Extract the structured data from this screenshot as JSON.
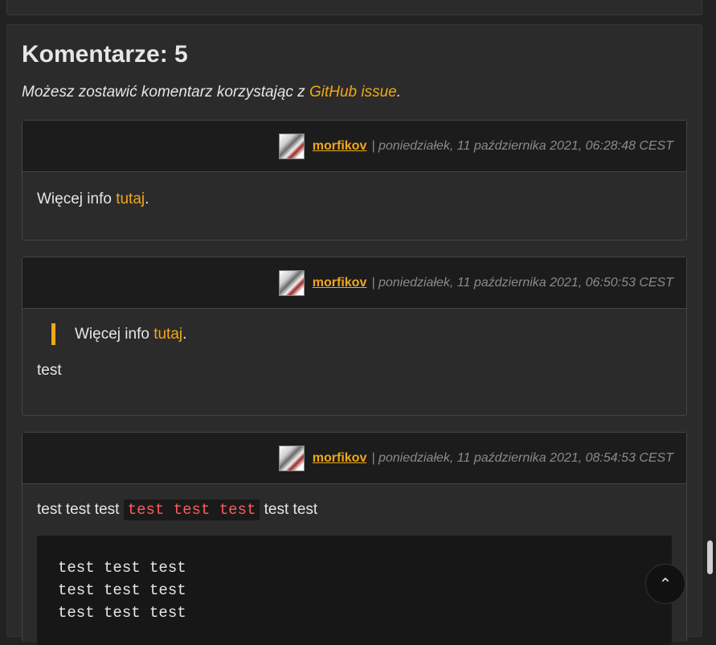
{
  "section": {
    "title": "Komentarze: 5",
    "intro_prefix": "Możesz zostawić komentarz korzystając z ",
    "intro_link": "GitHub issue",
    "intro_suffix": "."
  },
  "comments": [
    {
      "author": "morfikov",
      "meta": "| poniedziałek, 11 października 2021, 06:28:48 CEST",
      "text_prefix": "Więcej info ",
      "link": "tutaj",
      "text_suffix": "."
    },
    {
      "author": "morfikov",
      "meta": "| poniedziałek, 11 października 2021, 06:50:53 CEST",
      "quote_prefix": "Więcej info ",
      "quote_link": "tutaj",
      "quote_suffix": ".",
      "text": "test"
    },
    {
      "author": "morfikov",
      "meta": "| poniedziałek, 11 października 2021, 08:54:53 CEST",
      "text_prefix": "test test test ",
      "inline_code": "test test test",
      "text_suffix": " test test",
      "code_block": "test test test\ntest test test\ntest test test"
    }
  ],
  "icons": {
    "back_to_top": "chevron-up-icon",
    "avatar": "user-avatar"
  },
  "colors": {
    "accent": "#f0a818",
    "background": "#222222",
    "card": "#2b2b2b",
    "header": "#1c1c1c",
    "inline_code": "#ff5a5a"
  }
}
